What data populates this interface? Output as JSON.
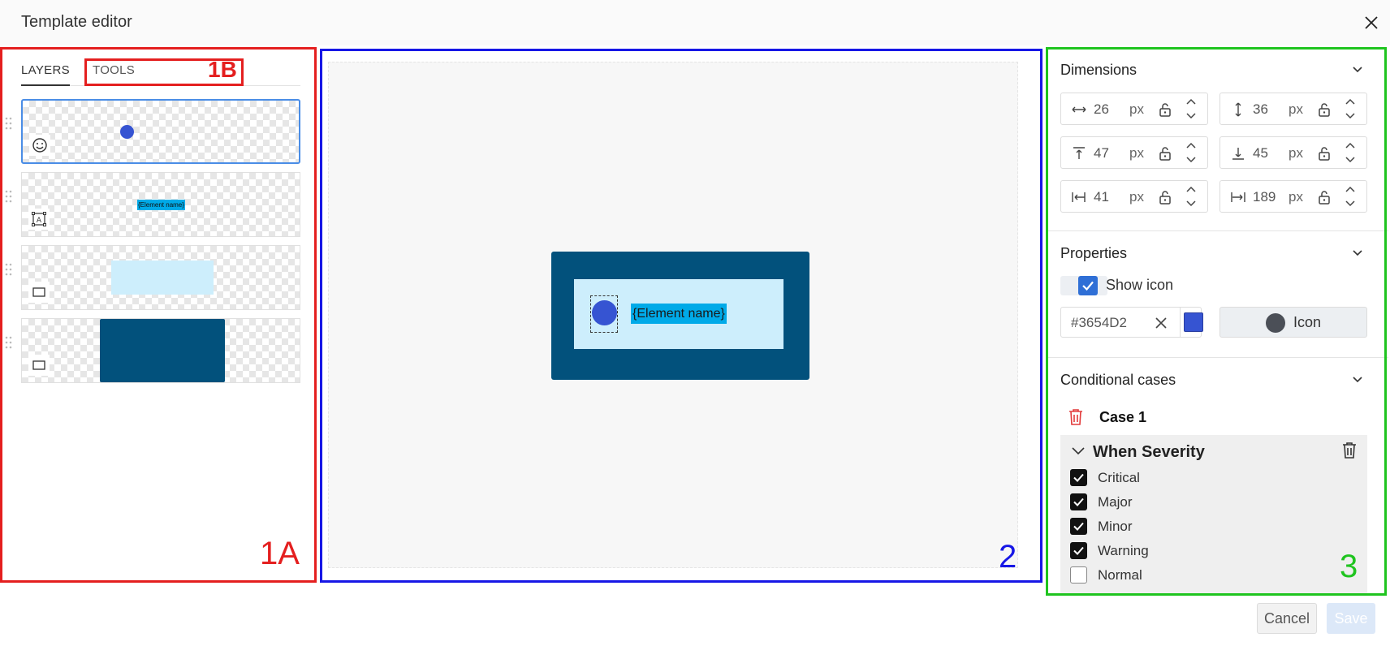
{
  "window": {
    "title": "Template editor"
  },
  "annotations": {
    "a1A": "1A",
    "a1B": "1B",
    "a2": "2",
    "a3": "3"
  },
  "left": {
    "tabs": [
      {
        "label": "LAYERS",
        "active": true
      },
      {
        "label": "TOOLS",
        "active": false
      }
    ],
    "layers": [
      {
        "kind": "icon",
        "icon": "smiley-icon"
      },
      {
        "kind": "text",
        "icon": "text-box-icon",
        "preview_text": "{Element name}"
      },
      {
        "kind": "rect-light",
        "icon": "rectangle-icon"
      },
      {
        "kind": "rect-dark",
        "icon": "rectangle-icon"
      }
    ]
  },
  "canvas": {
    "element_text": "{Element name}",
    "colors": {
      "outer": "#02517c",
      "inner": "#cdeefc",
      "text_bg": "#00aae8",
      "dot": "#3654d2"
    }
  },
  "right": {
    "dimensions": {
      "title": "Dimensions",
      "fields": [
        {
          "icon": "width-arrows-icon",
          "value": "26",
          "unit": "px"
        },
        {
          "icon": "height-arrows-icon",
          "value": "36",
          "unit": "px"
        },
        {
          "icon": "align-top-icon",
          "value": "47",
          "unit": "px"
        },
        {
          "icon": "align-bottom-icon",
          "value": "45",
          "unit": "px"
        },
        {
          "icon": "align-left-icon",
          "value": "41",
          "unit": "px"
        },
        {
          "icon": "align-right-icon",
          "value": "189",
          "unit": "px"
        }
      ]
    },
    "properties": {
      "title": "Properties",
      "show_icon_label": "Show icon",
      "color_value": "#3654D2",
      "icon_button_label": "Icon"
    },
    "conditional": {
      "title": "Conditional cases",
      "case_label": "Case 1",
      "when_label": "When Severity",
      "options": [
        {
          "label": "Critical",
          "checked": true
        },
        {
          "label": "Major",
          "checked": true
        },
        {
          "label": "Minor",
          "checked": true
        },
        {
          "label": "Warning",
          "checked": true
        },
        {
          "label": "Normal",
          "checked": false
        }
      ]
    }
  },
  "footer": {
    "cancel_label": "Cancel",
    "save_label": "Save"
  }
}
